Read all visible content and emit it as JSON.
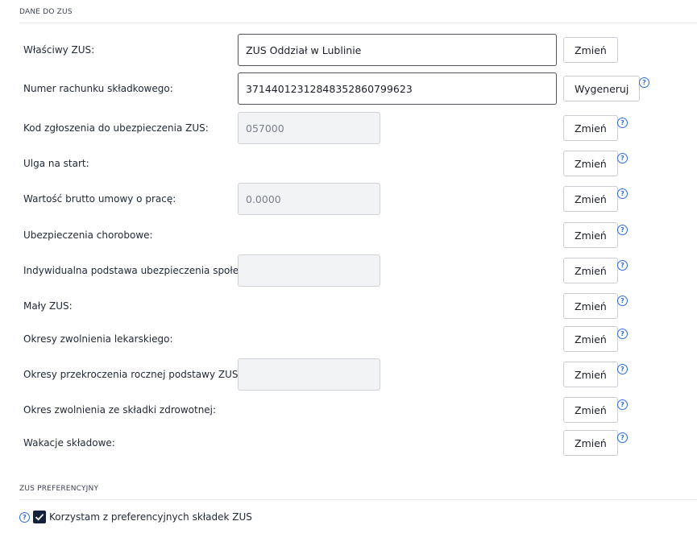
{
  "section_zus": {
    "title": "DANE DO ZUS"
  },
  "rows": {
    "wlasciwy_zus": {
      "label": "Właściwy ZUS:",
      "value": "ZUS Oddział w Lublinie",
      "button": "Zmień"
    },
    "numer_rachunku": {
      "label": "Numer rachunku składkowego:",
      "value": "37144012312848352860799623",
      "button": "Wygeneruj"
    },
    "kod_zgloszenia": {
      "label": "Kod zgłoszenia do ubezpieczenia ZUS:",
      "value": "057000",
      "button": "Zmień"
    },
    "ulga_na_start": {
      "label": "Ulga na start:",
      "button": "Zmień"
    },
    "wartosc_brutto": {
      "label": "Wartość brutto umowy o pracę:",
      "value": "0.0000",
      "button": "Zmień"
    },
    "ubezpieczenia_chorobowe": {
      "label": "Ubezpieczenia chorobowe:",
      "button": "Zmień"
    },
    "indywidualna_podstawa": {
      "label": "Indywidualna podstawa ubezpieczenia społecznego:",
      "value": "",
      "button": "Zmień"
    },
    "maly_zus": {
      "label": "Mały ZUS:",
      "button": "Zmień"
    },
    "okresy_zwolnienia": {
      "label": "Okresy zwolnienia lekarskiego:",
      "button": "Zmień"
    },
    "okresy_przekroczenia": {
      "label": "Okresy przekroczenia rocznej podstawy ZUS:",
      "value": "",
      "button": "Zmień"
    },
    "okres_zwolnienia_zdrowotnej": {
      "label": "Okres zwolnienia ze składki zdrowotnej:",
      "button": "Zmień"
    },
    "wakacje_skladowe": {
      "label": "Wakacje składowe:",
      "button": "Zmień"
    }
  },
  "help_icon": {
    "glyph": "?",
    "color": "#2b6de0"
  },
  "section_pref": {
    "title": "ZUS PREFERENCYJNY",
    "checkbox_label": "Korzystam z preferencyjnych składek ZUS",
    "checkbox_checked": true
  }
}
